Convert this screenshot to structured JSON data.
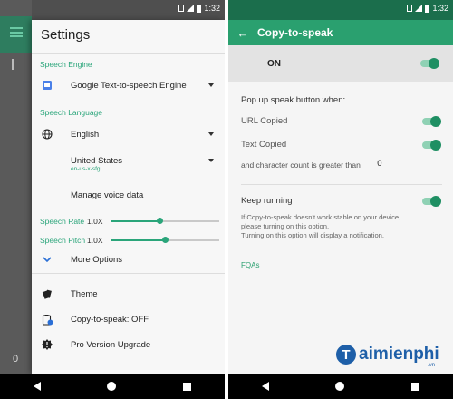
{
  "status": {
    "time": "1:32"
  },
  "left": {
    "rail_number": "0",
    "title": "Settings",
    "speech_engine_label": "Speech Engine",
    "engine_value": "Google Text-to-speech Engine",
    "speech_language_label": "Speech Language",
    "language_value": "English",
    "region_value": "United States",
    "region_code": "en-us-x-sfg",
    "manage_voice": "Manage voice data",
    "speech_rate": {
      "label": "Speech Rate",
      "value": "1.0X",
      "level": 0.45
    },
    "speech_pitch": {
      "label": "Speech Pitch",
      "value": "1.0X",
      "level": 0.5
    },
    "more_options": "More Options",
    "theme": "Theme",
    "copy_to_speak": "Copy-to-speak: OFF",
    "pro_upgrade": "Pro Version Upgrade"
  },
  "right": {
    "title": "Copy-to-speak",
    "master_label": "ON",
    "popup_heading": "Pop up speak button when:",
    "url_copied": "URL Copied",
    "text_copied": "Text Copied",
    "char_count_label": "and character count is greater than",
    "char_count_value": "0",
    "keep_running": "Keep running",
    "help_line1": "If Copy-to-speak doesn't work stable on your device,",
    "help_line2": "please turning on this option.",
    "help_line3": "Turning on this option will display a notification.",
    "fqas": "FQAs"
  },
  "watermark": {
    "logo_letter": "T",
    "text": "aimienphi",
    "suffix": ".vn"
  },
  "colors": {
    "accent": "#2aa06f",
    "appbar": "#2aa06f",
    "statusbar_right": "#1b6e4c"
  }
}
